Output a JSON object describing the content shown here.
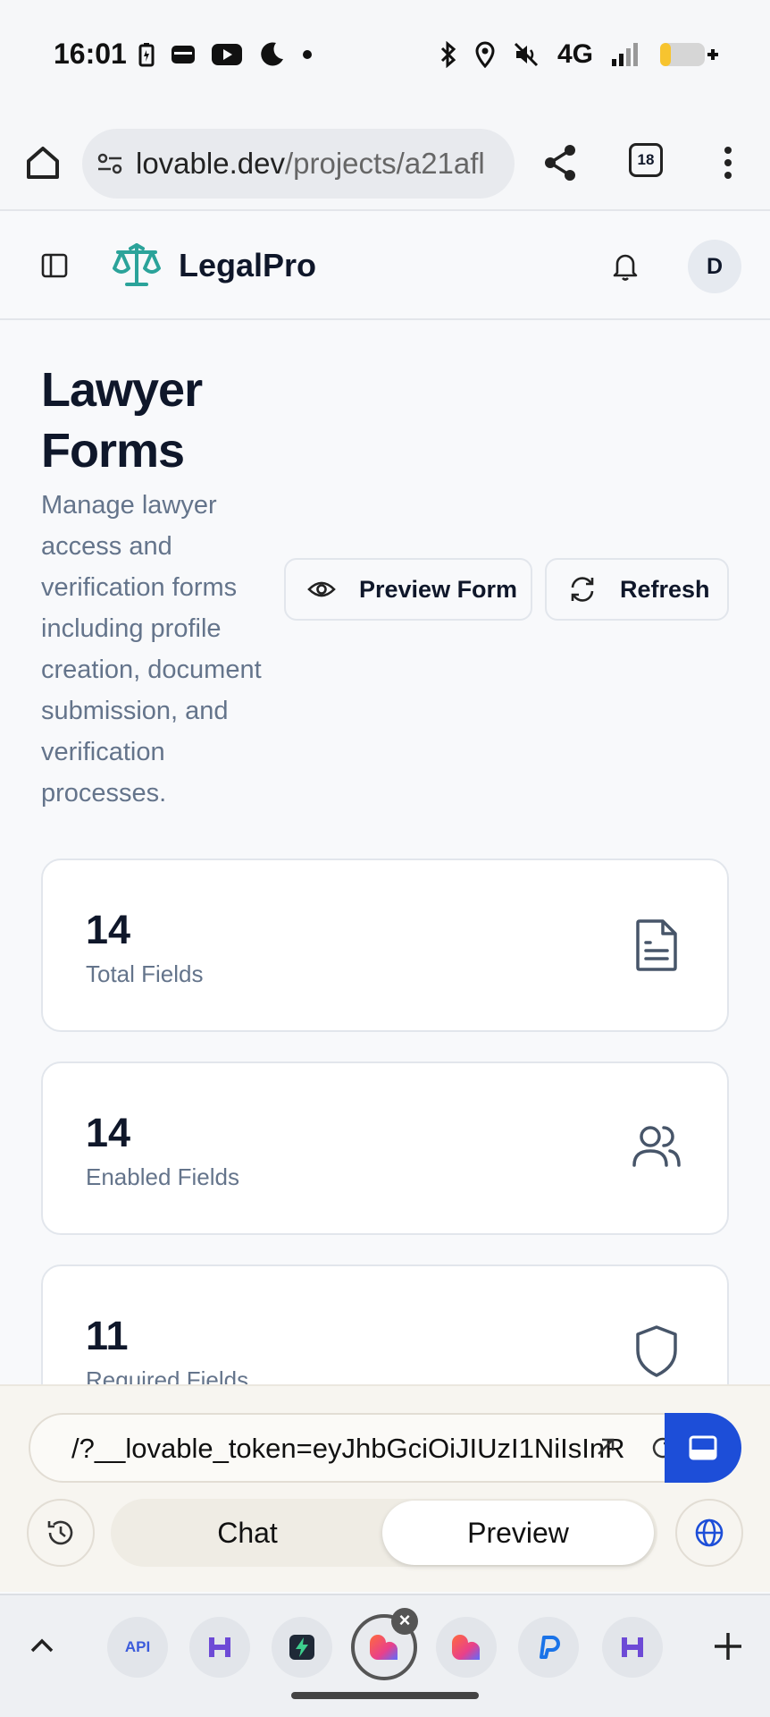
{
  "status_bar": {
    "time": "16:01",
    "network": "4G",
    "left_icons": [
      "battery-saver-icon",
      "wallet-icon",
      "youtube-icon",
      "do-not-disturb-moon-icon",
      "dot-icon"
    ],
    "right_icons": [
      "bluetooth-icon",
      "location-icon",
      "mute-icon",
      "signal-icon",
      "battery-icon"
    ]
  },
  "browser": {
    "url_host": "lovable.dev",
    "url_path": "/projects/a21afl",
    "tab_count": "18"
  },
  "app_header": {
    "brand": "LegalPro",
    "avatar_initial": "D",
    "brand_color": "#2ba39a"
  },
  "page": {
    "title": "Lawyer Forms",
    "description": "Manage lawyer access and verification forms including profile creation, document submission, and verification processes.",
    "preview_button": "Preview Form",
    "refresh_button": "Refresh"
  },
  "stats": [
    {
      "value": "14",
      "label": "Total Fields",
      "icon": "document-icon"
    },
    {
      "value": "14",
      "label": "Enabled Fields",
      "icon": "users-icon"
    },
    {
      "value": "11",
      "label": "Required Fields",
      "icon": "shield-icon"
    }
  ],
  "lovable_bar": {
    "token_url": "/?__lovable_token=eyJhbGciOiJIUzI1NiIsInR",
    "chat_label": "Chat",
    "preview_label": "Preview",
    "accent_color": "#1d4ed8"
  },
  "tab_strip": {
    "api_label": "API",
    "tabs": [
      "api-tab",
      "h-tab",
      "bolt-tab",
      "lovable-tab-active",
      "lovable-tab",
      "p-tab",
      "h-tab-2"
    ]
  }
}
